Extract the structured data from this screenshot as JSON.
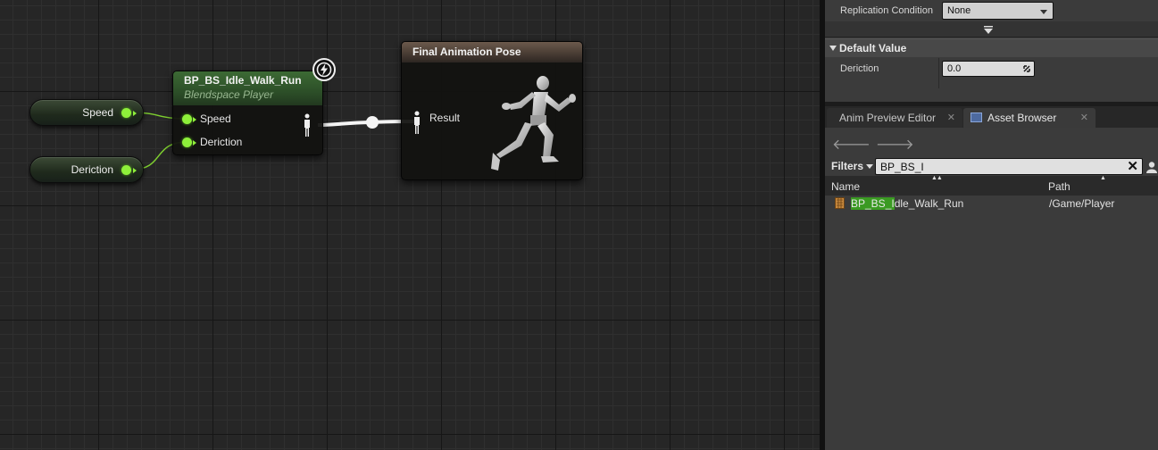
{
  "graph": {
    "var_speed": "Speed",
    "var_deriction": "Deriction",
    "blendspace_node": {
      "title": "BP_BS_Idle_Walk_Run",
      "subtitle": "Blendspace Player",
      "pins": [
        "Speed",
        "Deriction"
      ]
    },
    "final_pose_node": {
      "title": "Final Animation Pose",
      "result_label": "Result"
    }
  },
  "details": {
    "replication_condition_label": "Replication Condition",
    "replication_condition_value": "None",
    "default_value_header": "Default Value",
    "deriction_label": "Deriction",
    "deriction_value": "0.0"
  },
  "tabs": {
    "anim_preview": "Anim Preview Editor",
    "asset_browser": "Asset Browser"
  },
  "asset_browser": {
    "filters_label": "Filters",
    "search_value": "BP_BS_I",
    "columns": {
      "name": "Name",
      "path": "Path"
    },
    "rows": [
      {
        "name_match": "BP_BS_I",
        "name_rest": "dle_Walk_Run",
        "path": "/Game/Player"
      }
    ]
  },
  "colors": {
    "float_pin": "#8ef03a",
    "blendspace_header": "#3c6a34",
    "result_header": "#6c5a4c",
    "search_highlight": "#3a9a22"
  },
  "icons": [
    "lightning-icon",
    "pose-pin-icon",
    "mannequin-preview-icon",
    "asset-browser-tab-icon",
    "anim-asset-icon",
    "clear-icon",
    "user-icon"
  ]
}
